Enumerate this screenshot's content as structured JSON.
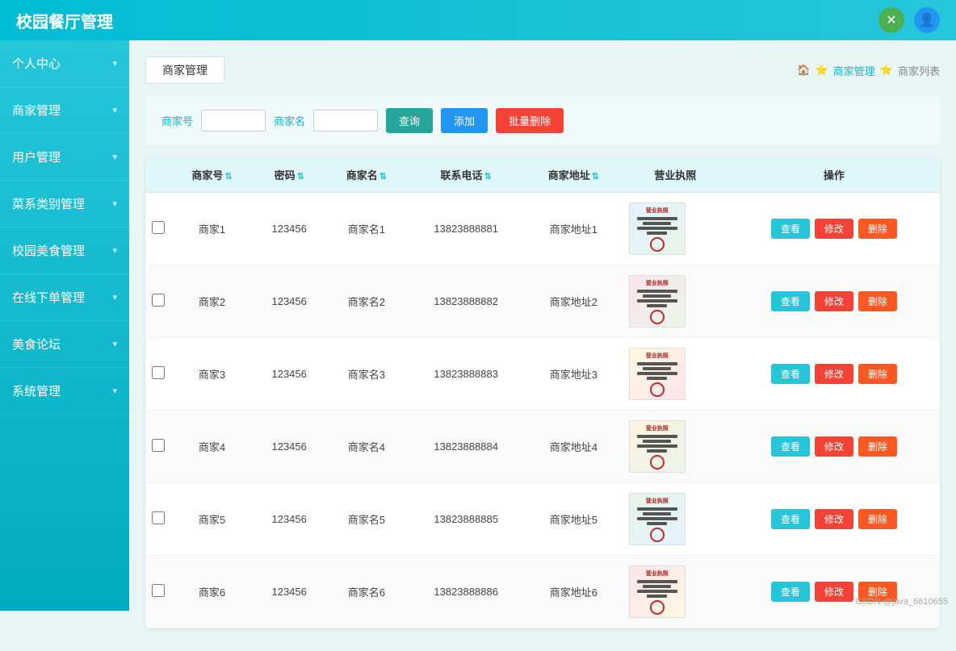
{
  "header": {
    "title": "校园餐厅管理",
    "refresh_icon": "⟳",
    "user_icon": "👤"
  },
  "breadcrumb": {
    "home_icon": "🏠",
    "items": [
      "商家管理",
      "商家列表"
    ]
  },
  "page_title": "商家管理",
  "filter": {
    "merchant_id_label": "商家号",
    "merchant_name_label": "商家名",
    "merchant_id_placeholder": "",
    "merchant_name_placeholder": "",
    "search_btn": "查询",
    "add_btn": "添加",
    "batch_delete_btn": "批量删除"
  },
  "table": {
    "columns": [
      "商家号",
      "密码",
      "商家名",
      "联系电话",
      "商家地址",
      "营业执照",
      "操作"
    ],
    "rows": [
      {
        "id": "商家1",
        "password": "123456",
        "name": "商家名1",
        "phone": "13823888881",
        "address": "商家地址1",
        "lic_class": "lic-img-1"
      },
      {
        "id": "商家2",
        "password": "123456",
        "name": "商家名2",
        "phone": "13823888882",
        "address": "商家地址2",
        "lic_class": "lic-img-2"
      },
      {
        "id": "商家3",
        "password": "123456",
        "name": "商家名3",
        "phone": "13823888883",
        "address": "商家地址3",
        "lic_class": "lic-img-3"
      },
      {
        "id": "商家4",
        "password": "123456",
        "name": "商家名4",
        "phone": "13823888884",
        "address": "商家地址4",
        "lic_class": "lic-img-4"
      },
      {
        "id": "商家5",
        "password": "123456",
        "name": "商家名5",
        "phone": "13823888885",
        "address": "商家地址5",
        "lic_class": "lic-img-5"
      },
      {
        "id": "商家6",
        "password": "123456",
        "name": "商家名6",
        "phone": "13823888886",
        "address": "商家地址6",
        "lic_class": "lic-img-6"
      }
    ],
    "action_view": "查看",
    "action_edit": "修改",
    "action_delete": "删除"
  },
  "sidebar": {
    "items": [
      {
        "label": "个人中心",
        "arrow": "▾"
      },
      {
        "label": "商家管理",
        "arrow": "▾"
      },
      {
        "label": "用户管理",
        "arrow": "▾"
      },
      {
        "label": "菜系类别管理",
        "arrow": "▾"
      },
      {
        "label": "校园美食管理",
        "arrow": "▾"
      },
      {
        "label": "在线下单管理",
        "arrow": "▾"
      },
      {
        "label": "美食论坛",
        "arrow": "▾"
      },
      {
        "label": "系统管理",
        "arrow": "▾"
      }
    ]
  },
  "footer_note": "CSDN @java_6610655"
}
